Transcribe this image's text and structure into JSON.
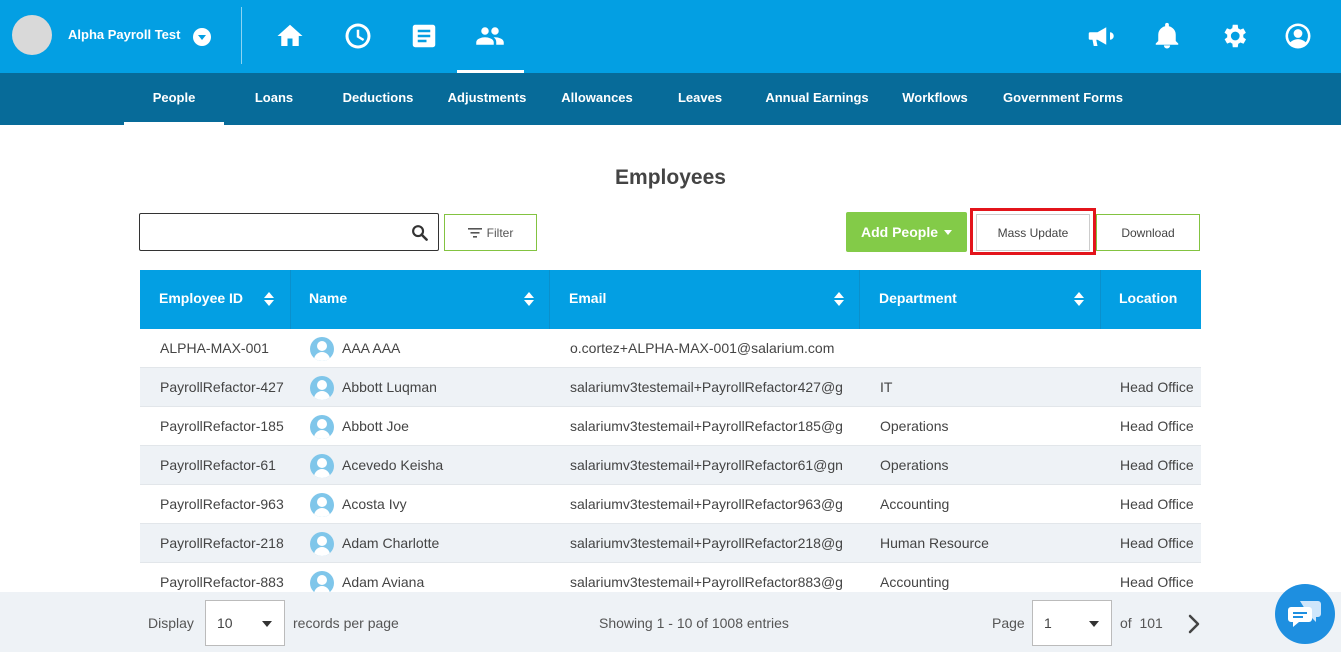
{
  "header": {
    "company_name": "Alpha Payroll Test",
    "nav_icons": [
      "home-icon",
      "clock-icon",
      "document-icon",
      "people-icon"
    ],
    "right_icons": [
      "megaphone-icon",
      "bell-icon",
      "gear-icon",
      "user-icon"
    ]
  },
  "subnav": {
    "items": [
      {
        "label": "People",
        "active": true
      },
      {
        "label": "Loans"
      },
      {
        "label": "Deductions"
      },
      {
        "label": "Adjustments"
      },
      {
        "label": "Allowances"
      },
      {
        "label": "Leaves"
      },
      {
        "label": "Annual Earnings"
      },
      {
        "label": "Workflows"
      },
      {
        "label": "Government Forms"
      }
    ]
  },
  "page": {
    "title": "Employees",
    "search_placeholder": "",
    "filter_label": "Filter",
    "add_people_label": "Add People",
    "mass_update_label": "Mass Update",
    "download_label": "Download"
  },
  "table": {
    "columns": [
      "Employee ID",
      "Name",
      "Email",
      "Department",
      "Location"
    ],
    "rows": [
      {
        "id": "ALPHA-MAX-001",
        "name": "AAA AAA",
        "email": "o.cortez+ALPHA-MAX-001@salarium.com",
        "department": "",
        "location": ""
      },
      {
        "id": "PayrollRefactor-427",
        "name": "Abbott Luqman",
        "email": "salariumv3testemail+PayrollRefactor427@g",
        "department": "IT",
        "location": "Head Office"
      },
      {
        "id": "PayrollRefactor-185",
        "name": "Abbott Joe",
        "email": "salariumv3testemail+PayrollRefactor185@g",
        "department": "Operations",
        "location": "Head Office"
      },
      {
        "id": "PayrollRefactor-61",
        "name": "Acevedo Keisha",
        "email": "salariumv3testemail+PayrollRefactor61@gn",
        "department": "Operations",
        "location": "Head Office"
      },
      {
        "id": "PayrollRefactor-963",
        "name": "Acosta Ivy",
        "email": "salariumv3testemail+PayrollRefactor963@g",
        "department": "Accounting",
        "location": "Head Office"
      },
      {
        "id": "PayrollRefactor-218",
        "name": "Adam Charlotte",
        "email": "salariumv3testemail+PayrollRefactor218@g",
        "department": "Human Resource",
        "location": "Head Office"
      },
      {
        "id": "PayrollRefactor-883",
        "name": "Adam Aviana",
        "email": "salariumv3testemail+PayrollRefactor883@g",
        "department": "Accounting",
        "location": "Head Office"
      }
    ]
  },
  "footer": {
    "display_label": "Display",
    "per_page_value": "10",
    "records_label": "records per page",
    "showing_text": "Showing 1 - 10 of 1008 entries",
    "page_label": "Page",
    "page_value": "1",
    "of_text": "of  101"
  },
  "colors": {
    "primary": "#039fe3",
    "subnav": "#076b99",
    "accent_green": "#83cb48",
    "highlight_red": "#e3141b"
  }
}
